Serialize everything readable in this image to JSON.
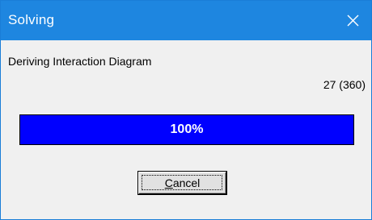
{
  "window": {
    "title": "Solving",
    "close_icon": "close-icon"
  },
  "content": {
    "status_text": "Deriving Interaction Diagram",
    "count_text": "27 (360)"
  },
  "progress": {
    "value_percent": 100,
    "label": "100%",
    "fill_color": "#0000ff"
  },
  "buttons": {
    "cancel_mnemonic": "C",
    "cancel_rest": "ancel"
  },
  "colors": {
    "titlebar": "#1e86e0",
    "dialog_background": "#f0f0f0"
  }
}
